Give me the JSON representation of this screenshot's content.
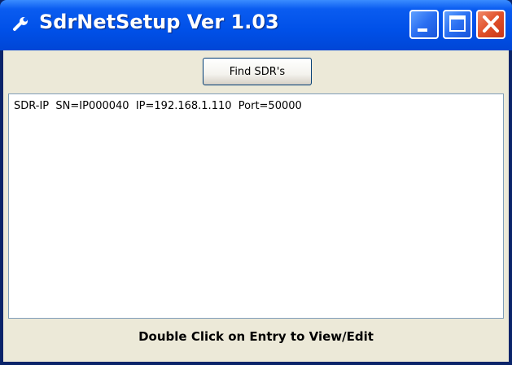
{
  "window": {
    "title": "SdrNetSetup Ver 1.03",
    "icons": {
      "app": "wrench-icon",
      "minimize": "minimize-icon",
      "maximize": "maximize-icon",
      "close": "close-icon"
    }
  },
  "toolbar": {
    "find_label": "Find SDR's"
  },
  "list": {
    "items": [
      {
        "text": "SDR-IP  SN=IP000040  IP=192.168.1.110  Port=50000"
      }
    ]
  },
  "status": {
    "text": "Double Click on Entry to View/Edit"
  },
  "colors": {
    "titlebar": "#0050E8",
    "client": "#ECE9D8",
    "close_button": "#E0502A"
  }
}
